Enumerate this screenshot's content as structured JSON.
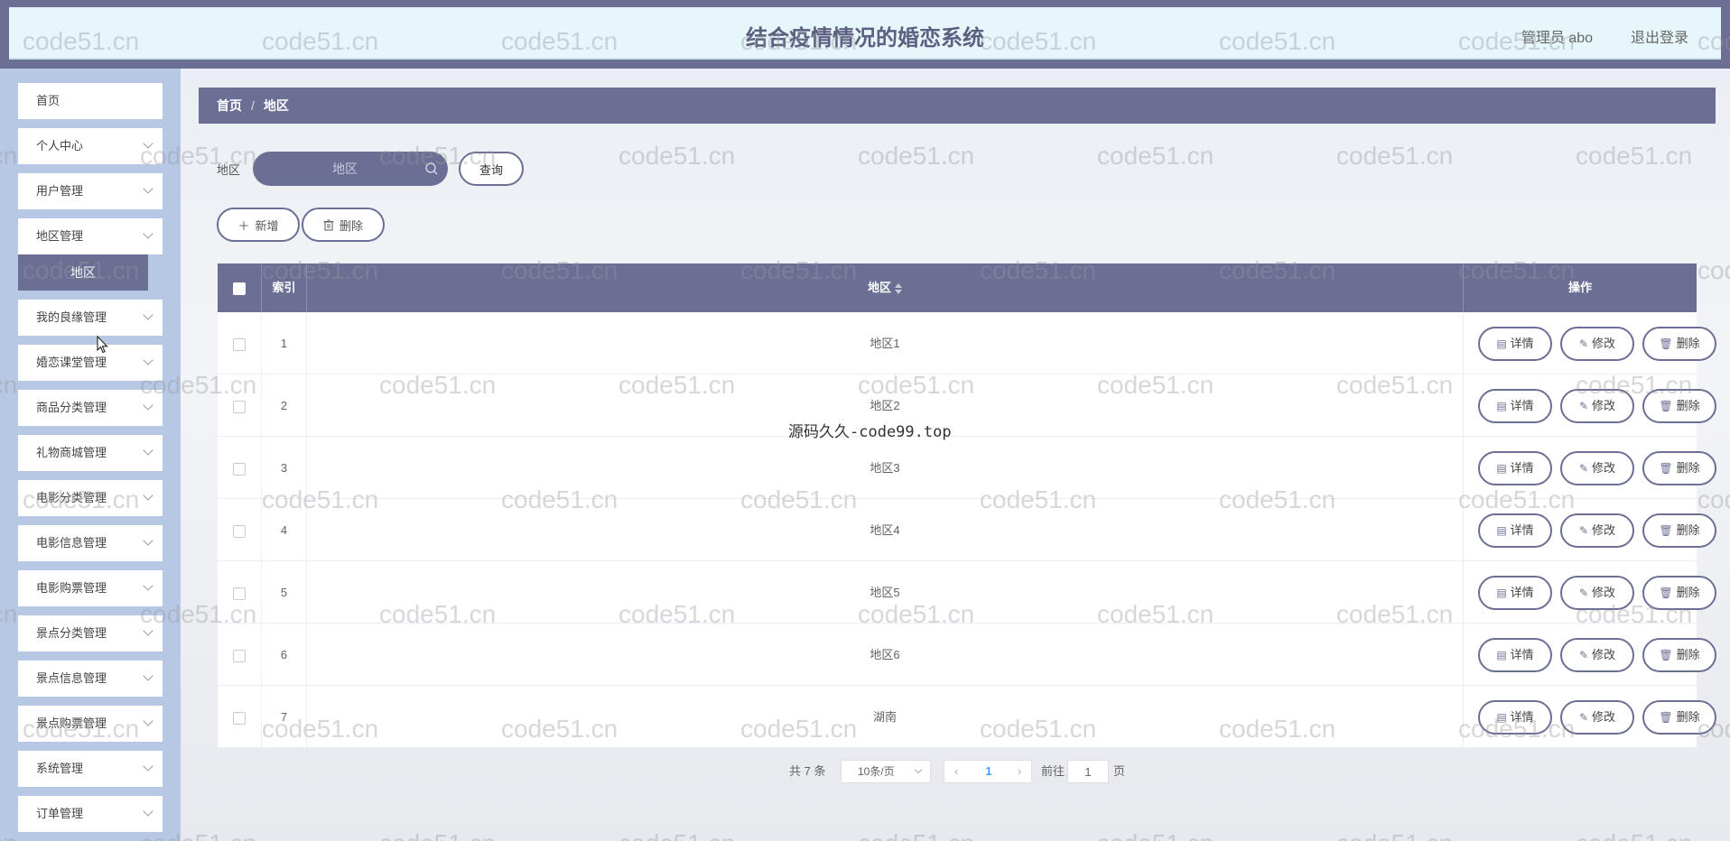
{
  "header": {
    "title": "结合疫情情况的婚恋系统",
    "user": "管理员 abo",
    "logout": "退出登录"
  },
  "sidebar": {
    "items": [
      {
        "label": "首页",
        "expandable": false
      },
      {
        "label": "个人中心",
        "expandable": true
      },
      {
        "label": "用户管理",
        "expandable": true
      },
      {
        "label": "地区管理",
        "expandable": true
      },
      {
        "label": "我的良缘管理",
        "expandable": true
      },
      {
        "label": "婚恋课堂管理",
        "expandable": true
      },
      {
        "label": "商品分类管理",
        "expandable": true
      },
      {
        "label": "礼物商城管理",
        "expandable": true
      },
      {
        "label": "电影分类管理",
        "expandable": true
      },
      {
        "label": "电影信息管理",
        "expandable": true
      },
      {
        "label": "电影购票管理",
        "expandable": true
      },
      {
        "label": "景点分类管理",
        "expandable": true
      },
      {
        "label": "景点信息管理",
        "expandable": true
      },
      {
        "label": "景点购票管理",
        "expandable": true
      },
      {
        "label": "系统管理",
        "expandable": true
      },
      {
        "label": "订单管理",
        "expandable": true
      }
    ],
    "active_sub": "地区"
  },
  "breadcrumb": {
    "home": "首页",
    "separator": "/",
    "current": "地区"
  },
  "search": {
    "label": "地区",
    "placeholder": "地区",
    "button": "查询"
  },
  "toolbar": {
    "add": "新增",
    "delete": "删除"
  },
  "table": {
    "headers": {
      "index": "索引",
      "area": "地区",
      "ops": "操作"
    },
    "rows": [
      {
        "index": "1",
        "area": "地区1"
      },
      {
        "index": "2",
        "area": "地区2"
      },
      {
        "index": "3",
        "area": "地区3"
      },
      {
        "index": "4",
        "area": "地区4"
      },
      {
        "index": "5",
        "area": "地区5"
      },
      {
        "index": "6",
        "area": "地区6"
      },
      {
        "index": "7",
        "area": "湖南"
      }
    ],
    "row_actions": {
      "detail": "详情",
      "edit": "修改",
      "delete": "删除"
    }
  },
  "pagination": {
    "total": "共 7 条",
    "page_size": "10条/页",
    "current_page": "1",
    "goto_label": "前往",
    "goto_value": "1",
    "goto_unit": "页"
  },
  "watermark": {
    "text": "code51.cn",
    "center": "源码久久-code99.top"
  },
  "colors": {
    "primary": "#6c6f94",
    "header_bg": "#e6f6fb",
    "sidebar_bg": "#b6c8e4"
  }
}
